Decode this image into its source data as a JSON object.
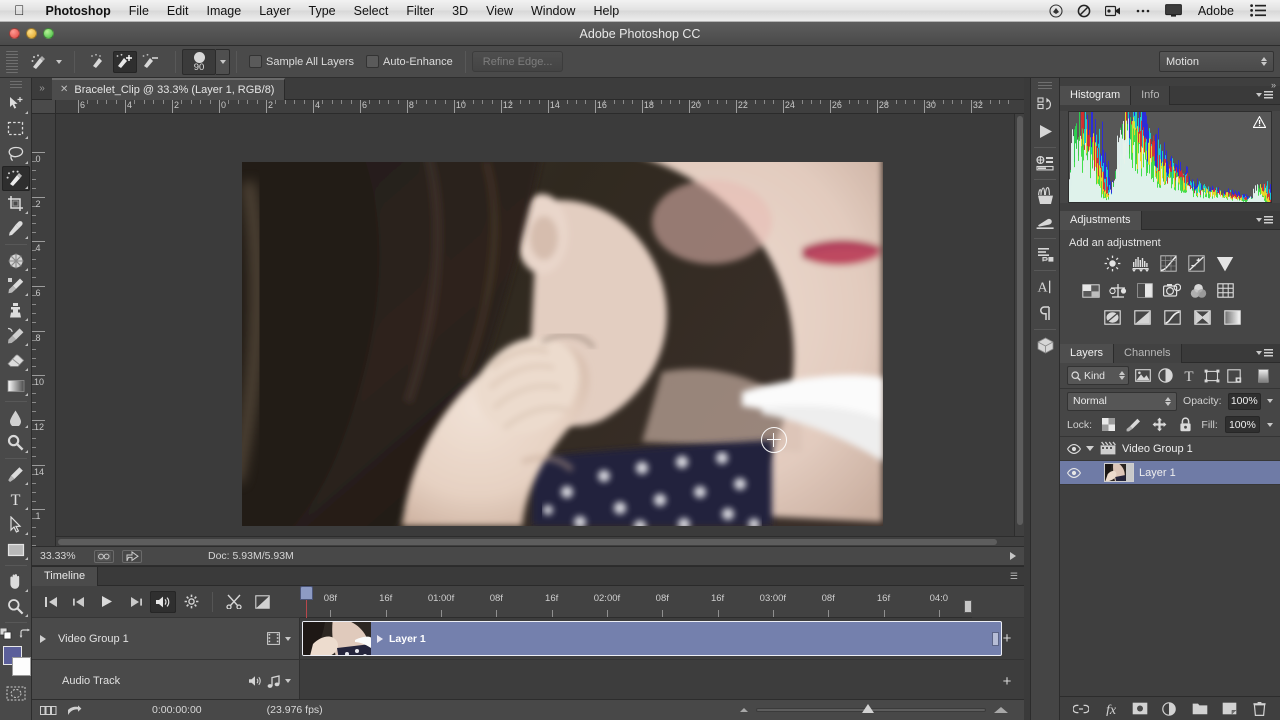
{
  "os_menu": {
    "apple_icon": "apple-logo-icon",
    "items": [
      "Photoshop",
      "File",
      "Edit",
      "Image",
      "Layer",
      "Type",
      "Select",
      "Filter",
      "3D",
      "View",
      "Window",
      "Help"
    ],
    "status_icons": [
      "dropbox-icon",
      "nodrive-icon",
      "screen-record-icon",
      "ellipsis-icon",
      "display-icon"
    ],
    "status_text": "Adobe",
    "menu_list_icon": "list-menu-icon"
  },
  "title_bar": {
    "title": "Adobe Photoshop CC"
  },
  "options_bar": {
    "tool_icon": "quick-selection-tool-icon",
    "mode_new_icon": "selection-new-icon",
    "mode_add_icon": "selection-add-icon",
    "mode_subtract_icon": "selection-subtract-icon",
    "brush_size": "90",
    "sample_all_layers_label": "Sample All Layers",
    "auto_enhance_label": "Auto-Enhance",
    "refine_edge_label": "Refine Edge...",
    "workspace": "Motion"
  },
  "toolbar": {
    "tools": [
      {
        "name": "move-tool",
        "active": false
      },
      {
        "name": "rectangular-marquee-tool",
        "active": false
      },
      {
        "name": "lasso-tool",
        "active": false
      },
      {
        "name": "quick-selection-tool",
        "active": true
      },
      {
        "name": "crop-tool",
        "active": false
      },
      {
        "name": "eyedropper-tool",
        "active": false
      },
      {
        "name": "spot-healing-brush-tool",
        "active": false
      },
      {
        "name": "brush-tool",
        "active": false
      },
      {
        "name": "clone-stamp-tool",
        "active": false
      },
      {
        "name": "history-brush-tool",
        "active": false
      },
      {
        "name": "eraser-tool",
        "active": false
      },
      {
        "name": "gradient-tool",
        "active": false
      },
      {
        "name": "blur-tool",
        "active": false
      },
      {
        "name": "dodge-tool",
        "active": false
      },
      {
        "name": "pen-tool",
        "active": false
      },
      {
        "name": "type-tool",
        "active": false
      },
      {
        "name": "path-selection-tool",
        "active": false
      },
      {
        "name": "rectangle-shape-tool",
        "active": false
      },
      {
        "name": "hand-tool",
        "active": false
      },
      {
        "name": "zoom-tool",
        "active": false
      }
    ],
    "foreground_color": "#5b5f9a",
    "background_color": "#ffffff",
    "quick_mask_icon": "quick-mask-icon"
  },
  "document": {
    "tab_title": "Bracelet_Clip @ 33.3% (Layer 1, RGB/8)",
    "ruler_h_labels": [
      "6",
      "4",
      "2",
      "0",
      "2",
      "4",
      "6",
      "8",
      "10",
      "12",
      "14",
      "16",
      "18",
      "20",
      "22",
      "24",
      "26",
      "28",
      "30",
      "32"
    ],
    "ruler_v_labels": [
      "0",
      "2",
      "4",
      "6",
      "8",
      "10",
      "12",
      "14",
      "1"
    ]
  },
  "status_bar": {
    "zoom": "33.33%",
    "doc_size": "Doc: 5.93M/5.93M"
  },
  "timeline": {
    "tab_label": "Timeline",
    "controls": [
      {
        "name": "go-to-first-frame-button",
        "icon": "first-frame-icon",
        "active": false
      },
      {
        "name": "previous-frame-button",
        "icon": "prev-frame-icon",
        "active": false
      },
      {
        "name": "play-button",
        "icon": "play-icon",
        "active": false
      },
      {
        "name": "next-frame-button",
        "icon": "next-frame-icon",
        "active": false
      },
      {
        "name": "audio-mute-button",
        "icon": "speaker-icon",
        "active": true
      },
      {
        "name": "render-settings-button",
        "icon": "gear-icon",
        "active": false
      },
      {
        "name": "split-clip-button",
        "icon": "scissors-icon",
        "active": false
      },
      {
        "name": "transition-button",
        "icon": "transition-icon",
        "active": false
      }
    ],
    "ruler_labels": [
      "08f",
      "16f",
      "01:00f",
      "08f",
      "16f",
      "02:00f",
      "08f",
      "16f",
      "03:00f",
      "08f",
      "16f",
      "04:0"
    ],
    "tracks": [
      {
        "name": "Video Group 1",
        "type": "video",
        "icon": "film-strip-icon"
      },
      {
        "name": "Audio Track",
        "type": "audio",
        "icon": "music-note-icon"
      }
    ],
    "clip_name": "Layer 1",
    "current_time": "0:00:00:00",
    "fps": "(23.976 fps)",
    "add_media_label": "+"
  },
  "mini_dock": {
    "icons": [
      "history-icon",
      "actions-play-icon",
      "properties-icon",
      "brush-icon",
      "brush-presets-icon",
      "paragraph-styles-icon",
      "character-icon",
      "paragraph-icon",
      "3d-icon"
    ]
  },
  "panels": {
    "histogram": {
      "tabs": [
        "Histogram",
        "Info"
      ],
      "active_tab": "Histogram",
      "warning_icon": "histogram-cache-warning-icon"
    },
    "adjustments": {
      "tab": "Adjustments",
      "title": "Add an adjustment",
      "rows": [
        [
          "brightness-contrast-icon",
          "levels-icon",
          "curves-icon",
          "exposure-icon",
          "vibrance-icon"
        ],
        [
          "hue-saturation-icon",
          "color-balance-icon",
          "black-white-icon",
          "photo-filter-icon",
          "channel-mixer-icon",
          "color-lookup-icon"
        ],
        [
          "invert-icon",
          "posterize-icon",
          "threshold-icon",
          "selective-color-icon",
          "gradient-map-icon"
        ]
      ]
    },
    "layers": {
      "tabs": [
        "Layers",
        "Channels"
      ],
      "active_tab": "Layers",
      "filter_kind_label": "Kind",
      "filter_icons": [
        "filter-pixel-icon",
        "filter-adjustment-icon",
        "filter-type-icon",
        "filter-shape-icon",
        "filter-smart-object-icon"
      ],
      "blend_mode": "Normal",
      "opacity_label": "Opacity:",
      "opacity_value": "100%",
      "lock_label": "Lock:",
      "lock_icons": [
        "lock-transparent-pixels-icon",
        "lock-image-pixels-icon",
        "lock-position-icon",
        "lock-all-icon"
      ],
      "fill_label": "Fill:",
      "fill_value": "100%",
      "items": [
        {
          "name": "Video Group 1",
          "type": "group",
          "selected": false,
          "visible": true
        },
        {
          "name": "Layer 1",
          "type": "video",
          "selected": true,
          "visible": true
        }
      ],
      "footer_icons": [
        "link-layers-icon",
        "layer-style-fx-icon",
        "add-layer-mask-icon",
        "new-adjustment-layer-icon",
        "new-group-icon",
        "new-layer-icon",
        "delete-layer-icon"
      ]
    }
  }
}
